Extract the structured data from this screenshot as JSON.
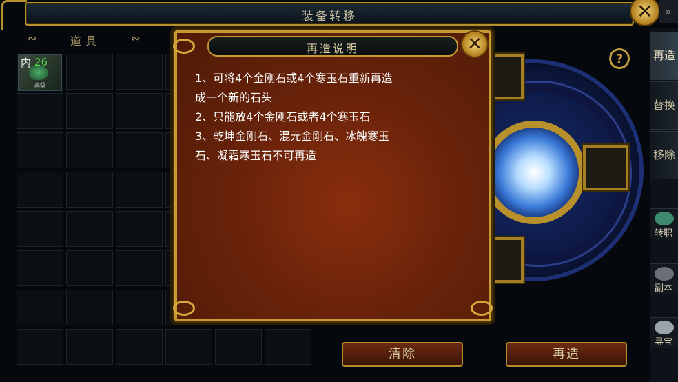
{
  "window": {
    "title": "装备转移"
  },
  "inventory": {
    "header": "道具",
    "header_ornament": "∾",
    "item": {
      "name": "内",
      "count": "26",
      "sublabel": "高级"
    }
  },
  "dialog": {
    "title": "再造说明",
    "lines": [
      "1、可将4个金刚石或4个寒玉石重新再造",
      "成一个新的石头",
      "2、只能放4个金刚石或者4个寒玉石",
      "3、乾坤金刚石、混元金刚石、冰魄寒玉",
      "石、凝霜寒玉石不可再造"
    ]
  },
  "help_icon": "?",
  "close_glyph": "✕",
  "side_tabs": [
    {
      "label": "再造",
      "active": true
    },
    {
      "label": "替换",
      "active": false
    },
    {
      "label": "移除",
      "active": false
    }
  ],
  "side_icons": [
    {
      "label": "转职",
      "icon": "teapot-icon",
      "color": "#3f8a6e"
    },
    {
      "label": "副本",
      "icon": "map-icon",
      "color": "#6b7076"
    },
    {
      "label": "寻宝",
      "icon": "dragon-icon",
      "color": "#9aa4ad"
    }
  ],
  "buttons": {
    "clear": "清除",
    "remake": "再造"
  },
  "colors": {
    "gold": "#c79b33",
    "dialog_bg": "#6a230a",
    "count_green": "#4fd24a"
  }
}
